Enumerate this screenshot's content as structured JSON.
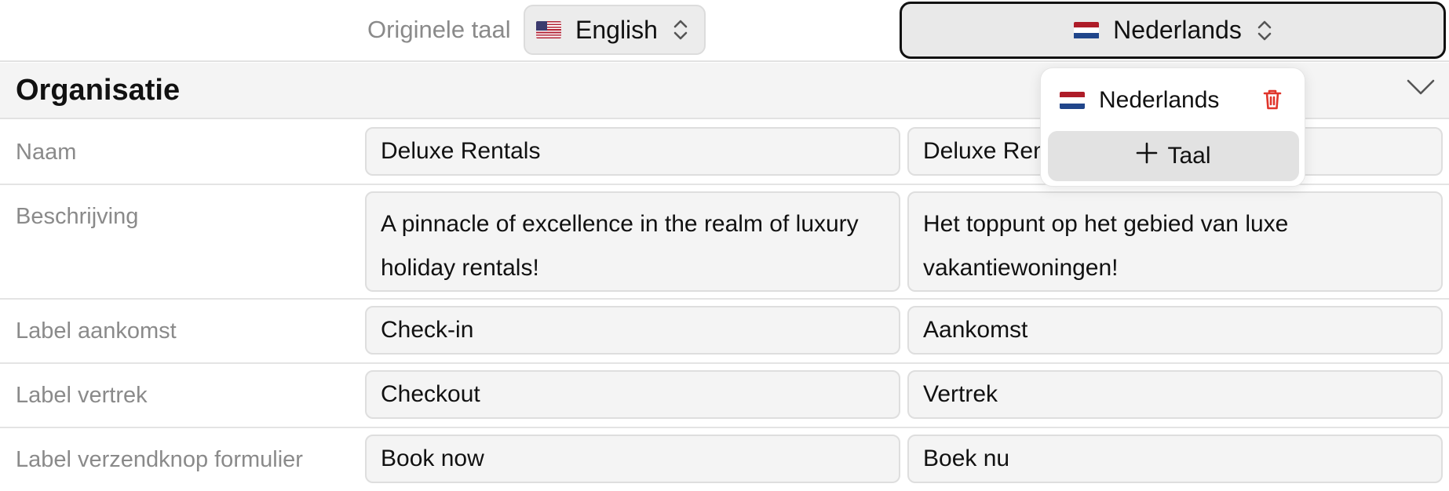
{
  "language_bar": {
    "original_label": "Originele taal",
    "original_language": "English",
    "target_language": "Nederlands"
  },
  "section": {
    "title": "Organisatie"
  },
  "rows": [
    {
      "label": "Naam",
      "original": "Deluxe Rentals",
      "translation": "Deluxe Rentals"
    },
    {
      "label": "Beschrijving",
      "original": "A pinnacle of excellence in the realm of luxury holiday rentals!",
      "translation": "Het toppunt op het gebied van luxe vakantiewoningen!"
    },
    {
      "label": "Label aankomst",
      "original": "Check-in",
      "translation": "Aankomst"
    },
    {
      "label": "Label vertrek",
      "original": "Checkout",
      "translation": "Vertrek"
    },
    {
      "label": "Label verzendknop formulier",
      "original": "Book now",
      "translation": "Boek nu"
    }
  ],
  "dropdown": {
    "items": [
      {
        "label": "Nederlands"
      }
    ],
    "add_label": "Taal"
  },
  "icons": {
    "original_flag": "us-flag-icon",
    "target_flag": "nl-flag-icon",
    "select_chevrons": "chevron-up-down-icon",
    "section_toggle": "chevron-down-icon",
    "delete": "trash-icon",
    "add": "plus-icon"
  },
  "colors": {
    "delete_icon": "#e0352b",
    "field_background": "#f4f4f4",
    "label_text": "#8a8a8a"
  }
}
